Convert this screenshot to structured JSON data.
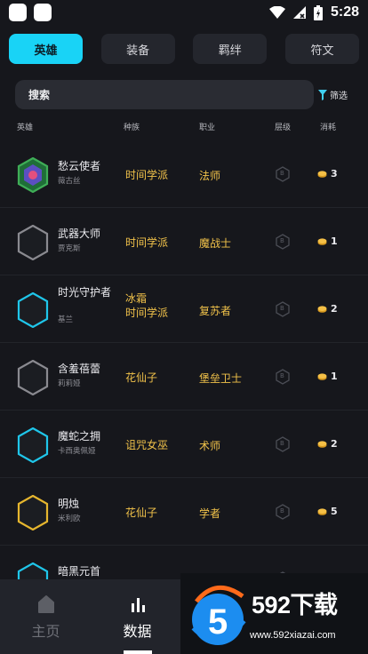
{
  "status_bar": {
    "time": "5:28"
  },
  "tabs": [
    "英雄",
    "装备",
    "羁绊",
    "符文"
  ],
  "search": {
    "label": "搜索"
  },
  "filter": {
    "label": "筛选"
  },
  "headers": {
    "hero": "英雄",
    "race": "种族",
    "job": "职业",
    "tier": "层级",
    "cost": "消耗"
  },
  "tier_badge": "B",
  "heroes": [
    {
      "name": "愁云使者",
      "sub": "薇古丝",
      "race": [
        "时间学派"
      ],
      "job": "法师",
      "cost": "3",
      "color": "#3fae57"
    },
    {
      "name": "武器大师",
      "sub": "贾克斯",
      "race": [
        "时间学派"
      ],
      "job": "魔战士",
      "cost": "1",
      "color": "#8a8a90"
    },
    {
      "name": "时光守护者",
      "sub": "基兰",
      "race": [
        "冰霜",
        "时间学派"
      ],
      "job": "复苏者",
      "cost": "2",
      "color": "#1fc6ea"
    },
    {
      "name": "含羞蓓蕾",
      "sub": "莉莉娅",
      "race": [
        "花仙子"
      ],
      "job": "堡垒卫士",
      "cost": "1",
      "color": "#8a8a90"
    },
    {
      "name": "魔蛇之拥",
      "sub": "卡西奥佩娅",
      "race": [
        "诅咒女巫"
      ],
      "job": "术师",
      "cost": "2",
      "color": "#1fc6ea"
    },
    {
      "name": "明烛",
      "sub": "米利欧",
      "race": [
        "花仙子"
      ],
      "job": "学者",
      "cost": "5",
      "color": "#e6b62e"
    },
    {
      "name": "暗黑元首",
      "sub": "",
      "race": [
        ""
      ],
      "job": "",
      "cost": "",
      "color": "#1fc6ea"
    }
  ],
  "nav": {
    "home": "主页",
    "data": "数据"
  },
  "watermark": {
    "text": "592下载",
    "url": "www.592xiazai.com"
  }
}
